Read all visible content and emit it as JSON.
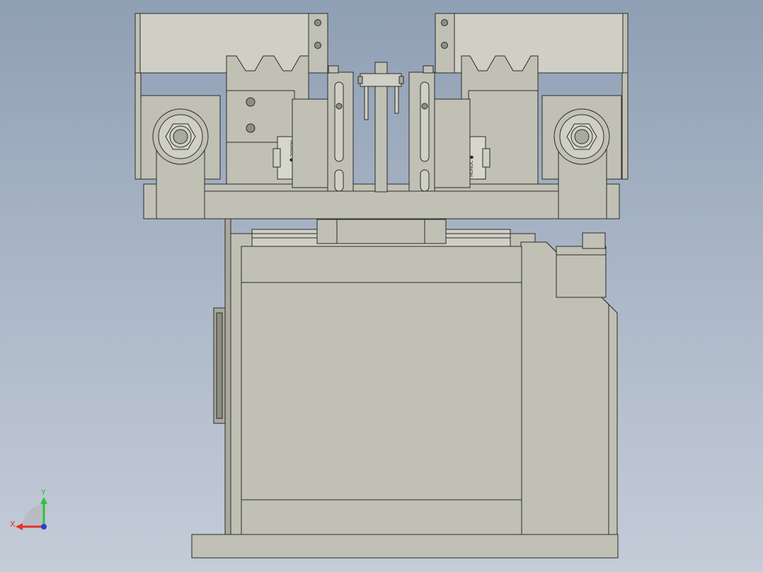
{
  "viewport": {
    "bg_top": "#8f9fb4",
    "bg_bottom": "#c4ccd8"
  },
  "model": {
    "fill": "#c0c0b5",
    "fill_dark": "#a9a99c",
    "fill_light": "#cfcfc5",
    "edge": "#2b2b2b",
    "hole": "#8e8e85"
  },
  "sensor_labels": {
    "left": "MONOC ●",
    "right": "MONOC ●"
  },
  "triad": {
    "x_label": "X",
    "y_label": "Y",
    "x_color": "#e8302b",
    "y_color": "#2bc43a",
    "z_color": "#2b3fd6"
  }
}
